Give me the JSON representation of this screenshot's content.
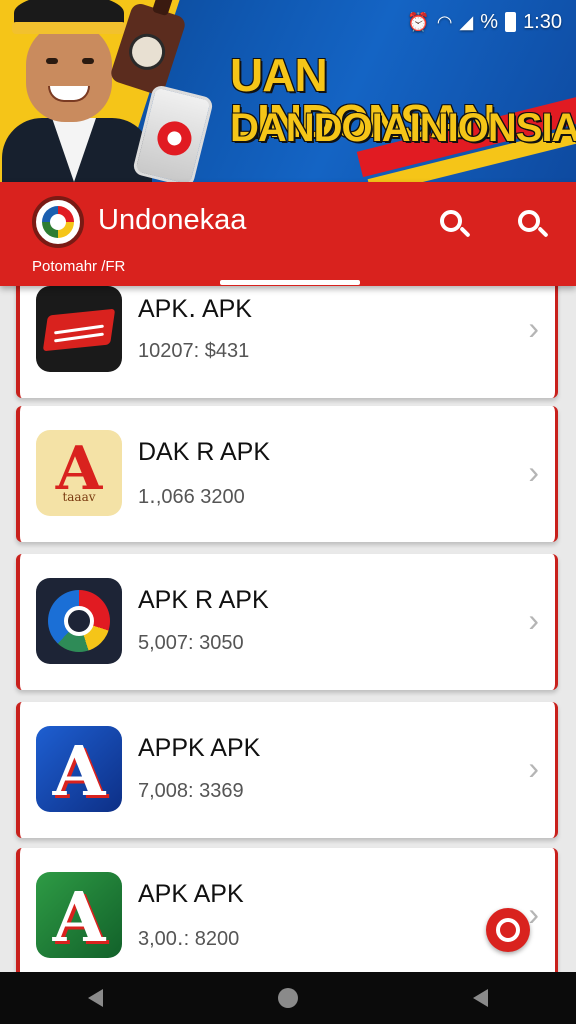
{
  "status_bar": {
    "time": "1:30",
    "icons": [
      "alarm-icon",
      "wifi-icon",
      "signal-icon",
      "battery-icon"
    ],
    "percent_glyph": "%"
  },
  "banner": {
    "line1": "UAN LINDONSAN",
    "line2": "DANDOIAINIONSIA"
  },
  "app_bar": {
    "title": "Undonekaa",
    "subtitle": "Potomahr /FR",
    "actions": [
      "search-icon",
      "search-icon"
    ]
  },
  "apps": [
    {
      "name": "APK․ APK",
      "meta": "10207: $431",
      "icon": "red-wave-icon"
    },
    {
      "name": "DAK R APK",
      "meta": "1․,066 3200",
      "icon": "letter-a-icon",
      "icon_caption": "taaav"
    },
    {
      "name": "APK R APK",
      "meta": "5,007: 3050",
      "icon": "ring-icon"
    },
    {
      "name": "APPK APK",
      "meta": "7,008: 3369",
      "icon": "letter-a-icon"
    },
    {
      "name": "APK APK",
      "meta": "3,00․: 8200",
      "icon": "letter-a-icon"
    }
  ],
  "chevron": "›",
  "colors": {
    "accent": "#d9221e",
    "banner_blue": "#0f57b0",
    "banner_yellow": "#f5c518"
  }
}
